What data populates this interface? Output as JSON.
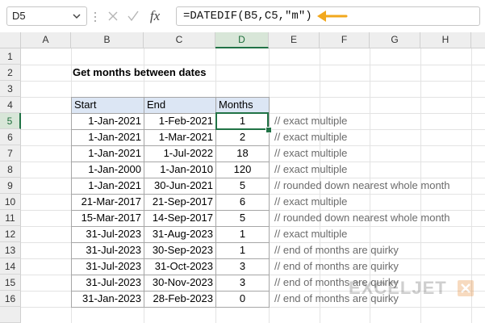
{
  "formula_bar": {
    "name_box": "D5",
    "formula": "=DATEDIF(B5,C5,\"m\")",
    "fx": "fx"
  },
  "colors": {
    "accent_green": "#217346",
    "header_fill": "#dce6f4",
    "arrow": "#f2a81d",
    "comment_text": "#6b6b6b"
  },
  "columns": [
    "A",
    "B",
    "C",
    "D",
    "E",
    "F",
    "G",
    "H"
  ],
  "rows": [
    "1",
    "2",
    "3",
    "4",
    "5",
    "6",
    "7",
    "8",
    "9",
    "10",
    "11",
    "12",
    "13",
    "14",
    "15",
    "16"
  ],
  "sheet": {
    "title": "Get months between dates",
    "headers": {
      "start": "Start",
      "end": "End",
      "months": "Months"
    },
    "data": [
      {
        "start": "1-Jan-2021",
        "end": "1-Feb-2021",
        "months": "1",
        "comment": "// exact multiple"
      },
      {
        "start": "1-Jan-2021",
        "end": "1-Mar-2021",
        "months": "2",
        "comment": "// exact multiple"
      },
      {
        "start": "1-Jan-2021",
        "end": "1-Jul-2022",
        "months": "18",
        "comment": "// exact multiple"
      },
      {
        "start": "1-Jan-2000",
        "end": "1-Jan-2010",
        "months": "120",
        "comment": "// exact multiple"
      },
      {
        "start": "1-Jan-2021",
        "end": "30-Jun-2021",
        "months": "5",
        "comment": "// rounded down nearest whole month"
      },
      {
        "start": "21-Mar-2017",
        "end": "21-Sep-2017",
        "months": "6",
        "comment": "// exact multiple"
      },
      {
        "start": "15-Mar-2017",
        "end": "14-Sep-2017",
        "months": "5",
        "comment": "// rounded down nearest whole month"
      },
      {
        "start": "31-Jul-2023",
        "end": "31-Aug-2023",
        "months": "1",
        "comment": "// exact multiple"
      },
      {
        "start": "31-Jul-2023",
        "end": "30-Sep-2023",
        "months": "1",
        "comment": "// end of months are quirky"
      },
      {
        "start": "31-Jul-2023",
        "end": "31-Oct-2023",
        "months": "3",
        "comment": "// end of months are quirky"
      },
      {
        "start": "31-Jul-2023",
        "end": "30-Nov-2023",
        "months": "3",
        "comment": "// end of months are quirky"
      },
      {
        "start": "31-Jan-2023",
        "end": "28-Feb-2023",
        "months": "0",
        "comment": "// end of months are quirky"
      }
    ]
  },
  "watermark": "EXCELJET"
}
